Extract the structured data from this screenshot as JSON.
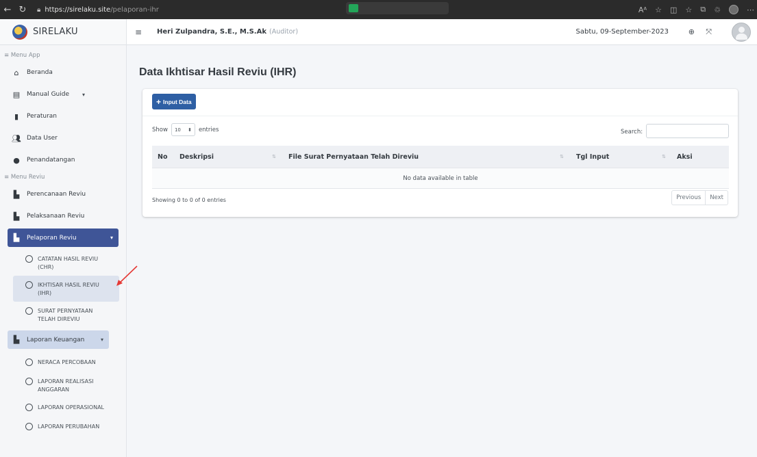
{
  "browser": {
    "url_host": "https://sirelaku.site",
    "url_path": "/pelaporan-ihr"
  },
  "brand": {
    "name": "SIRELAKU"
  },
  "topbar": {
    "user_name": "Heri Zulpandra, S.E., M.S.Ak",
    "user_role": "(Auditor)",
    "date": "Sabtu, 09-September-2023"
  },
  "sidebar": {
    "section_app": "Menu App",
    "app_items": [
      {
        "label": "Beranda",
        "icon": "home-icon"
      },
      {
        "label": "Manual Guide",
        "icon": "book-icon"
      },
      {
        "label": "Peraturan",
        "icon": "bookmark-icon"
      },
      {
        "label": "Data User",
        "icon": "users-icon"
      },
      {
        "label": "Penandatangan",
        "icon": "user-icon"
      }
    ],
    "section_reviu": "Menu Reviu",
    "reviu_items": [
      {
        "label": "Perencanaan Reviu",
        "icon": "file-icon"
      },
      {
        "label": "Pelaksanaan Reviu",
        "icon": "file-icon"
      },
      {
        "label": "Pelaporan Reviu",
        "icon": "file-icon"
      }
    ],
    "pelaporan_sub": [
      "CATATAN HASIL REVIU (CHR)",
      "IKHTISAR HASIL REVIU (IHR)",
      "SURAT PERNYATAAN TELAH DIREVIU"
    ],
    "keuangan_label": "Laporan Keuangan",
    "keuangan_sub": [
      "NERACA PERCOBAAN",
      "LAPORAN REALISASI ANGGARAN",
      "LAPORAN OPERASIONAL",
      "LAPORAN PERUBAHAN"
    ]
  },
  "main": {
    "page_title": "Data Ikhtisar Hasil Reviu (IHR)",
    "input_button": "Input Data",
    "show_label": "Show",
    "show_value": "10",
    "entries_label": "entries",
    "search_label": "Search:",
    "columns": [
      "No",
      "Deskripsi",
      "File Surat Pernyataan Telah Direviu",
      "Tgl Input",
      "Aksi"
    ],
    "empty_message": "No data available in table",
    "info": "Showing 0 to 0 of 0 entries",
    "pager": {
      "previous": "Previous",
      "next": "Next"
    }
  },
  "colors": {
    "accent_primary": "#2e5fa4",
    "sidebar_active": "#3f5597",
    "sidebar_light": "#ccd7ea",
    "arrow": "#e53935"
  }
}
